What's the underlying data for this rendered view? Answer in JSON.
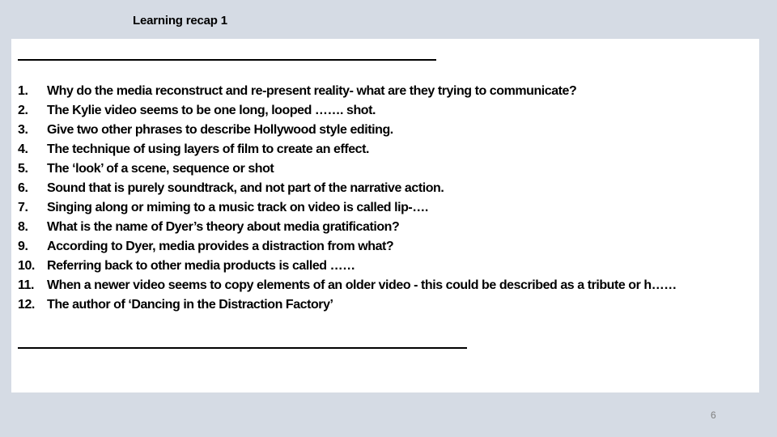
{
  "slide": {
    "title": "Learning recap 1",
    "page_number": "6",
    "questions": [
      {
        "num": "1.",
        "text": "Why do the media reconstruct and re-present reality- what are they trying to communicate?"
      },
      {
        "num": "2.",
        "text": "The Kylie video seems to be one long, looped ……. shot."
      },
      {
        "num": "3.",
        "text": "Give two other phrases to describe Hollywood style editing."
      },
      {
        "num": "4.",
        "text": "The technique of using layers of film to create an effect."
      },
      {
        "num": "5.",
        "text": "The ‘look’ of a scene, sequence or shot"
      },
      {
        "num": "6.",
        "text": "Sound that is purely soundtrack, and not part of the narrative action."
      },
      {
        "num": "7.",
        "text": "Singing along or miming to a music track on video is called lip-…."
      },
      {
        "num": "8.",
        "text": "What is the name of Dyer’s theory about media gratification?"
      },
      {
        "num": "9.",
        "text": "According to Dyer, media provides a distraction from what?"
      },
      {
        "num": "10.",
        "text": "Referring back to other media products is called ……"
      },
      {
        "num": "11.",
        "text": "When a newer video seems to copy elements of an older video - this could be described as a tribute or h……"
      },
      {
        "num": "12.",
        "text": "The author of ‘Dancing in the Distraction Factory’"
      }
    ]
  }
}
